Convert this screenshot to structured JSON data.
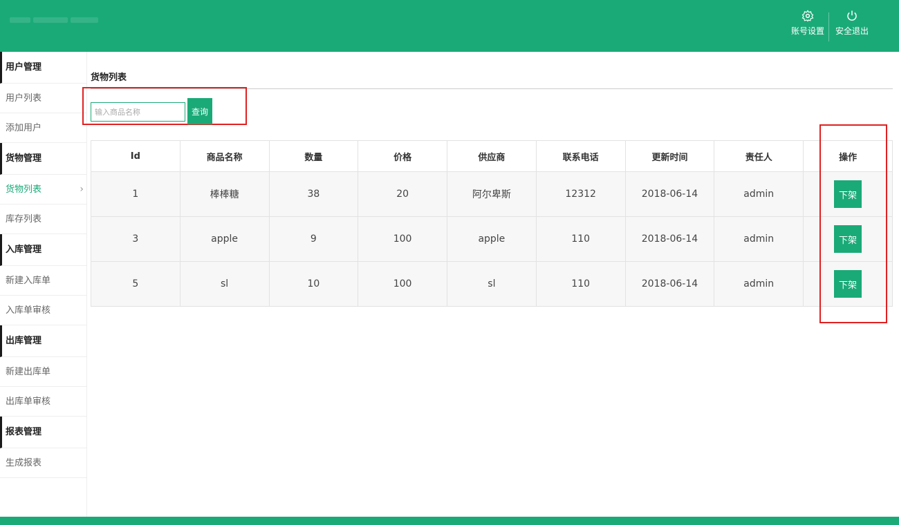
{
  "header": {
    "settings_label": "账号设置",
    "logout_label": "安全退出",
    "brand_color": "#1aaa78"
  },
  "sidebar": {
    "sections": [
      {
        "title": "用户管理",
        "items": [
          {
            "label": "用户列表"
          },
          {
            "label": "添加用户"
          }
        ]
      },
      {
        "title": "货物管理",
        "items": [
          {
            "label": "货物列表",
            "active": true
          },
          {
            "label": "库存列表"
          }
        ]
      },
      {
        "title": "入库管理",
        "items": [
          {
            "label": "新建入库单"
          },
          {
            "label": "入库单审核"
          }
        ]
      },
      {
        "title": "出库管理",
        "items": [
          {
            "label": "新建出库单"
          },
          {
            "label": "出库单审核"
          }
        ]
      },
      {
        "title": "报表管理",
        "items": [
          {
            "label": "生成报表"
          }
        ]
      }
    ]
  },
  "main": {
    "page_title": "货物列表",
    "search": {
      "placeholder": "输入商品名称",
      "button_label": "查询"
    },
    "table": {
      "columns": [
        "Id",
        "商品名称",
        "数量",
        "价格",
        "供应商",
        "联系电话",
        "更新时间",
        "责任人",
        "操作"
      ],
      "rows": [
        {
          "id": "1",
          "name": "棒棒糖",
          "qty": "38",
          "price": "20",
          "supplier": "阿尔卑斯",
          "phone": "12312",
          "updated": "2018-06-14",
          "owner": "admin",
          "action": "下架"
        },
        {
          "id": "3",
          "name": "apple",
          "qty": "9",
          "price": "100",
          "supplier": "apple",
          "phone": "110",
          "updated": "2018-06-14",
          "owner": "admin",
          "action": "下架"
        },
        {
          "id": "5",
          "name": "sl",
          "qty": "10",
          "price": "100",
          "supplier": "sl",
          "phone": "110",
          "updated": "2018-06-14",
          "owner": "admin",
          "action": "下架"
        }
      ]
    }
  }
}
